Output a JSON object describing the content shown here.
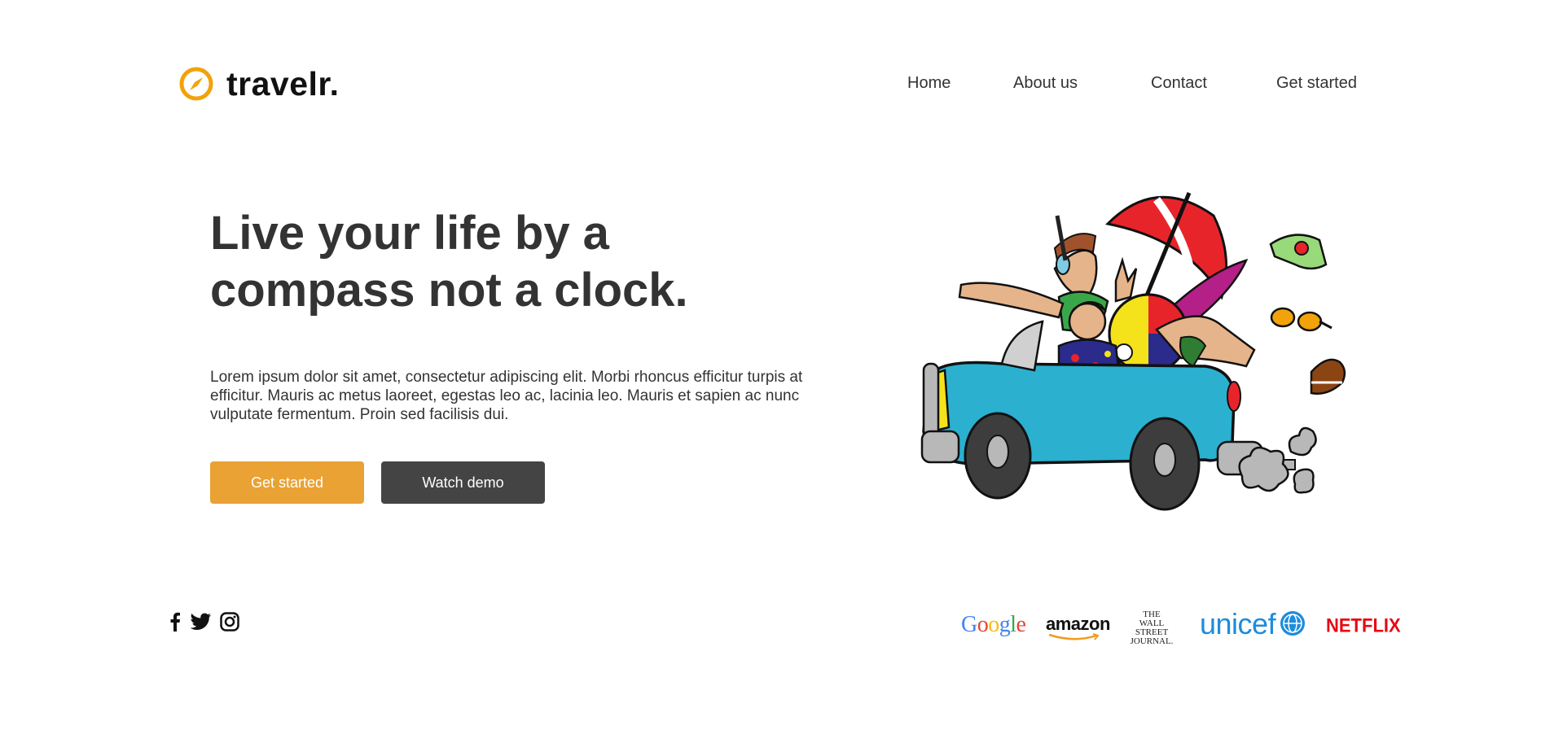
{
  "header": {
    "logo_text": "travelr.",
    "logo_icon": "compass-icon",
    "nav": [
      "Home",
      "About us",
      "Contact",
      "Get started"
    ]
  },
  "hero": {
    "title_line1": "Live your life by a",
    "title_line2": "compass not a clock.",
    "description": "Lorem ipsum dolor sit amet, consectetur adipiscing elit. Morbi rhoncus efficitur turpis at efficitur. Mauris ac metus laoreet, egestas leo ac, lacinia leo. Mauris et sapien ac nunc vulputate fermentum. Proin sed facilisis dui.",
    "primary_button": "Get started",
    "secondary_button": "Watch demo",
    "illustration": "road-trip-car-illustration"
  },
  "footer": {
    "social_icons": [
      "facebook-icon",
      "twitter-icon",
      "instagram-icon"
    ],
    "brands": {
      "google": "Google",
      "amazon": "amazon",
      "wsj_line1": "THE",
      "wsj_line2": "WALL STREET",
      "wsj_line3": "JOURNAL.",
      "unicef": "unicef",
      "netflix": "NETFLIX"
    }
  },
  "colors": {
    "accent": "#e9a233",
    "dark_button": "#444444",
    "text": "#333333",
    "logo_icon": "#f2a20a"
  }
}
